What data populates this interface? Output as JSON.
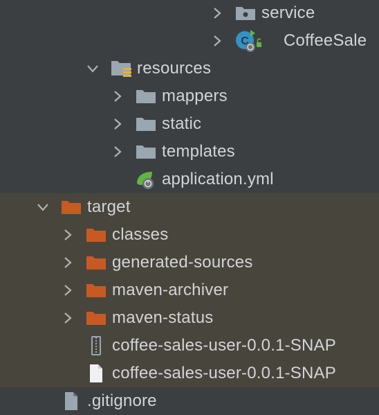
{
  "colors": {
    "background": "#3c3f41",
    "excluded_background": "#48453c",
    "folder_gray": "#9aa7b0",
    "folder_excluded": "#c75a23",
    "spring_green": "#62b543",
    "text": "#d2d4d6"
  },
  "tree": {
    "items": [
      {
        "label": "service",
        "icon": "package-folder-icon",
        "arrow": "collapsed"
      },
      {
        "label": "CoffeeSale",
        "icon": "spring-boot-class-icon",
        "arrow": "collapsed"
      },
      {
        "label": "resources",
        "icon": "resources-folder-icon",
        "arrow": "expanded"
      },
      {
        "label": "mappers",
        "icon": "folder-icon",
        "arrow": "collapsed"
      },
      {
        "label": "static",
        "icon": "folder-icon",
        "arrow": "collapsed"
      },
      {
        "label": "templates",
        "icon": "folder-icon",
        "arrow": "collapsed"
      },
      {
        "label": "application.yml",
        "icon": "spring-config-file-icon",
        "arrow": "none"
      },
      {
        "label": "target",
        "icon": "excluded-folder-icon",
        "arrow": "expanded"
      },
      {
        "label": "classes",
        "icon": "excluded-folder-icon",
        "arrow": "collapsed"
      },
      {
        "label": "generated-sources",
        "icon": "excluded-folder-icon",
        "arrow": "collapsed"
      },
      {
        "label": "maven-archiver",
        "icon": "excluded-folder-icon",
        "arrow": "collapsed"
      },
      {
        "label": "maven-status",
        "icon": "excluded-folder-icon",
        "arrow": "collapsed"
      },
      {
        "label": "coffee-sales-user-0.0.1-SNAP",
        "icon": "jar-archive-icon",
        "arrow": "none"
      },
      {
        "label": "coffee-sales-user-0.0.1-SNAP",
        "icon": "file-icon",
        "arrow": "none"
      },
      {
        "label": ".gitignore",
        "icon": "gitignore-file-icon",
        "arrow": "none"
      }
    ]
  }
}
